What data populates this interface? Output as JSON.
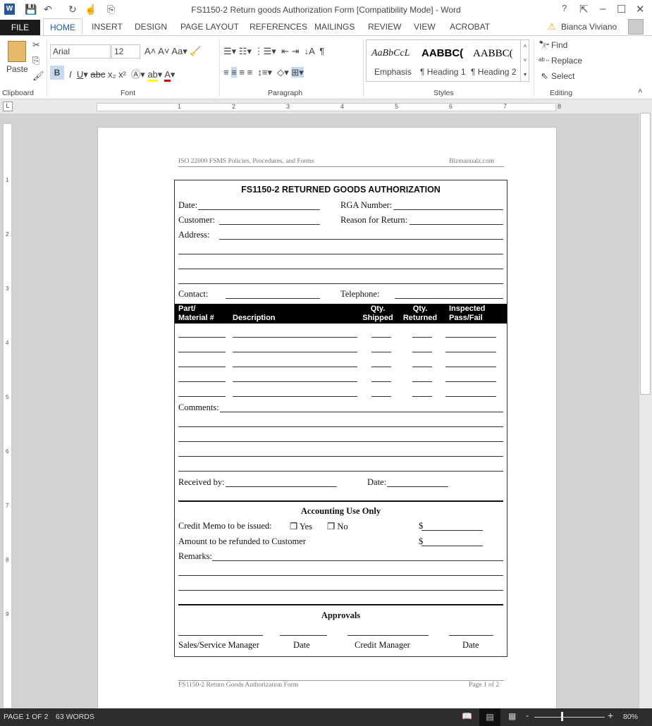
{
  "app": {
    "title": "FS1150-2 Return goods Authorization Form [Compatibility Mode] - Word",
    "help": "?",
    "user": "Bianca Viviano"
  },
  "tabs": [
    "FILE",
    "HOME",
    "INSERT",
    "DESIGN",
    "PAGE LAYOUT",
    "REFERENCES",
    "MAILINGS",
    "REVIEW",
    "VIEW",
    "ACROBAT"
  ],
  "ribbon": {
    "paste": "Paste",
    "font_name": "Arial",
    "font_size": "12",
    "groups": [
      "Clipboard",
      "Font",
      "Paragraph",
      "Styles",
      "Editing"
    ],
    "styles": [
      {
        "preview": "AaBbCcL",
        "name": "Emphasis"
      },
      {
        "preview": "AABBC(",
        "name": "¶ Heading 1"
      },
      {
        "preview": "AABBC(",
        "name": "¶ Heading 2"
      }
    ],
    "editing": {
      "find": "Find",
      "replace": "Replace",
      "select": "Select"
    }
  },
  "doc": {
    "header_left": "ISO 22000 FSMS Policies, Procedures, and Forms",
    "header_right": "Bizmanualz.com",
    "form_title": "FS1150-2   RETURNED GOODS AUTHORIZATION",
    "date": "Date:",
    "rga": "RGA Number:",
    "customer": "Customer:",
    "reason": "Reason for Return:",
    "address": "Address:",
    "contact": "Contact:",
    "telephone": "Telephone:",
    "columns": [
      [
        "Part/",
        "Material #"
      ],
      [
        "",
        "Description"
      ],
      [
        "Qty.",
        "Shipped"
      ],
      [
        "Qty.",
        "Returned"
      ],
      [
        "Inspected",
        "Pass/Fail"
      ]
    ],
    "comments": "Comments:",
    "received_by": "Received by:",
    "date2": "Date:",
    "accounting": "Accounting Use Only",
    "credit_memo": "Credit Memo to be issued:",
    "yes": "❒ Yes",
    "no": "❒ No",
    "dollar": "$",
    "refund": "Amount to be refunded to Customer",
    "remarks": "Remarks:",
    "approvals": "Approvals",
    "sig_labels": [
      "Sales/Service Manager",
      "Date",
      "Credit Manager",
      "Date"
    ],
    "footer_left": "FS1150-2 Return Goods Authorization  Form",
    "footer_right": "Page 1 of 2"
  },
  "status": {
    "page": "PAGE 1 OF 2",
    "words": "63 WORDS",
    "zoom": "80%",
    "zoom_percent": 80
  }
}
